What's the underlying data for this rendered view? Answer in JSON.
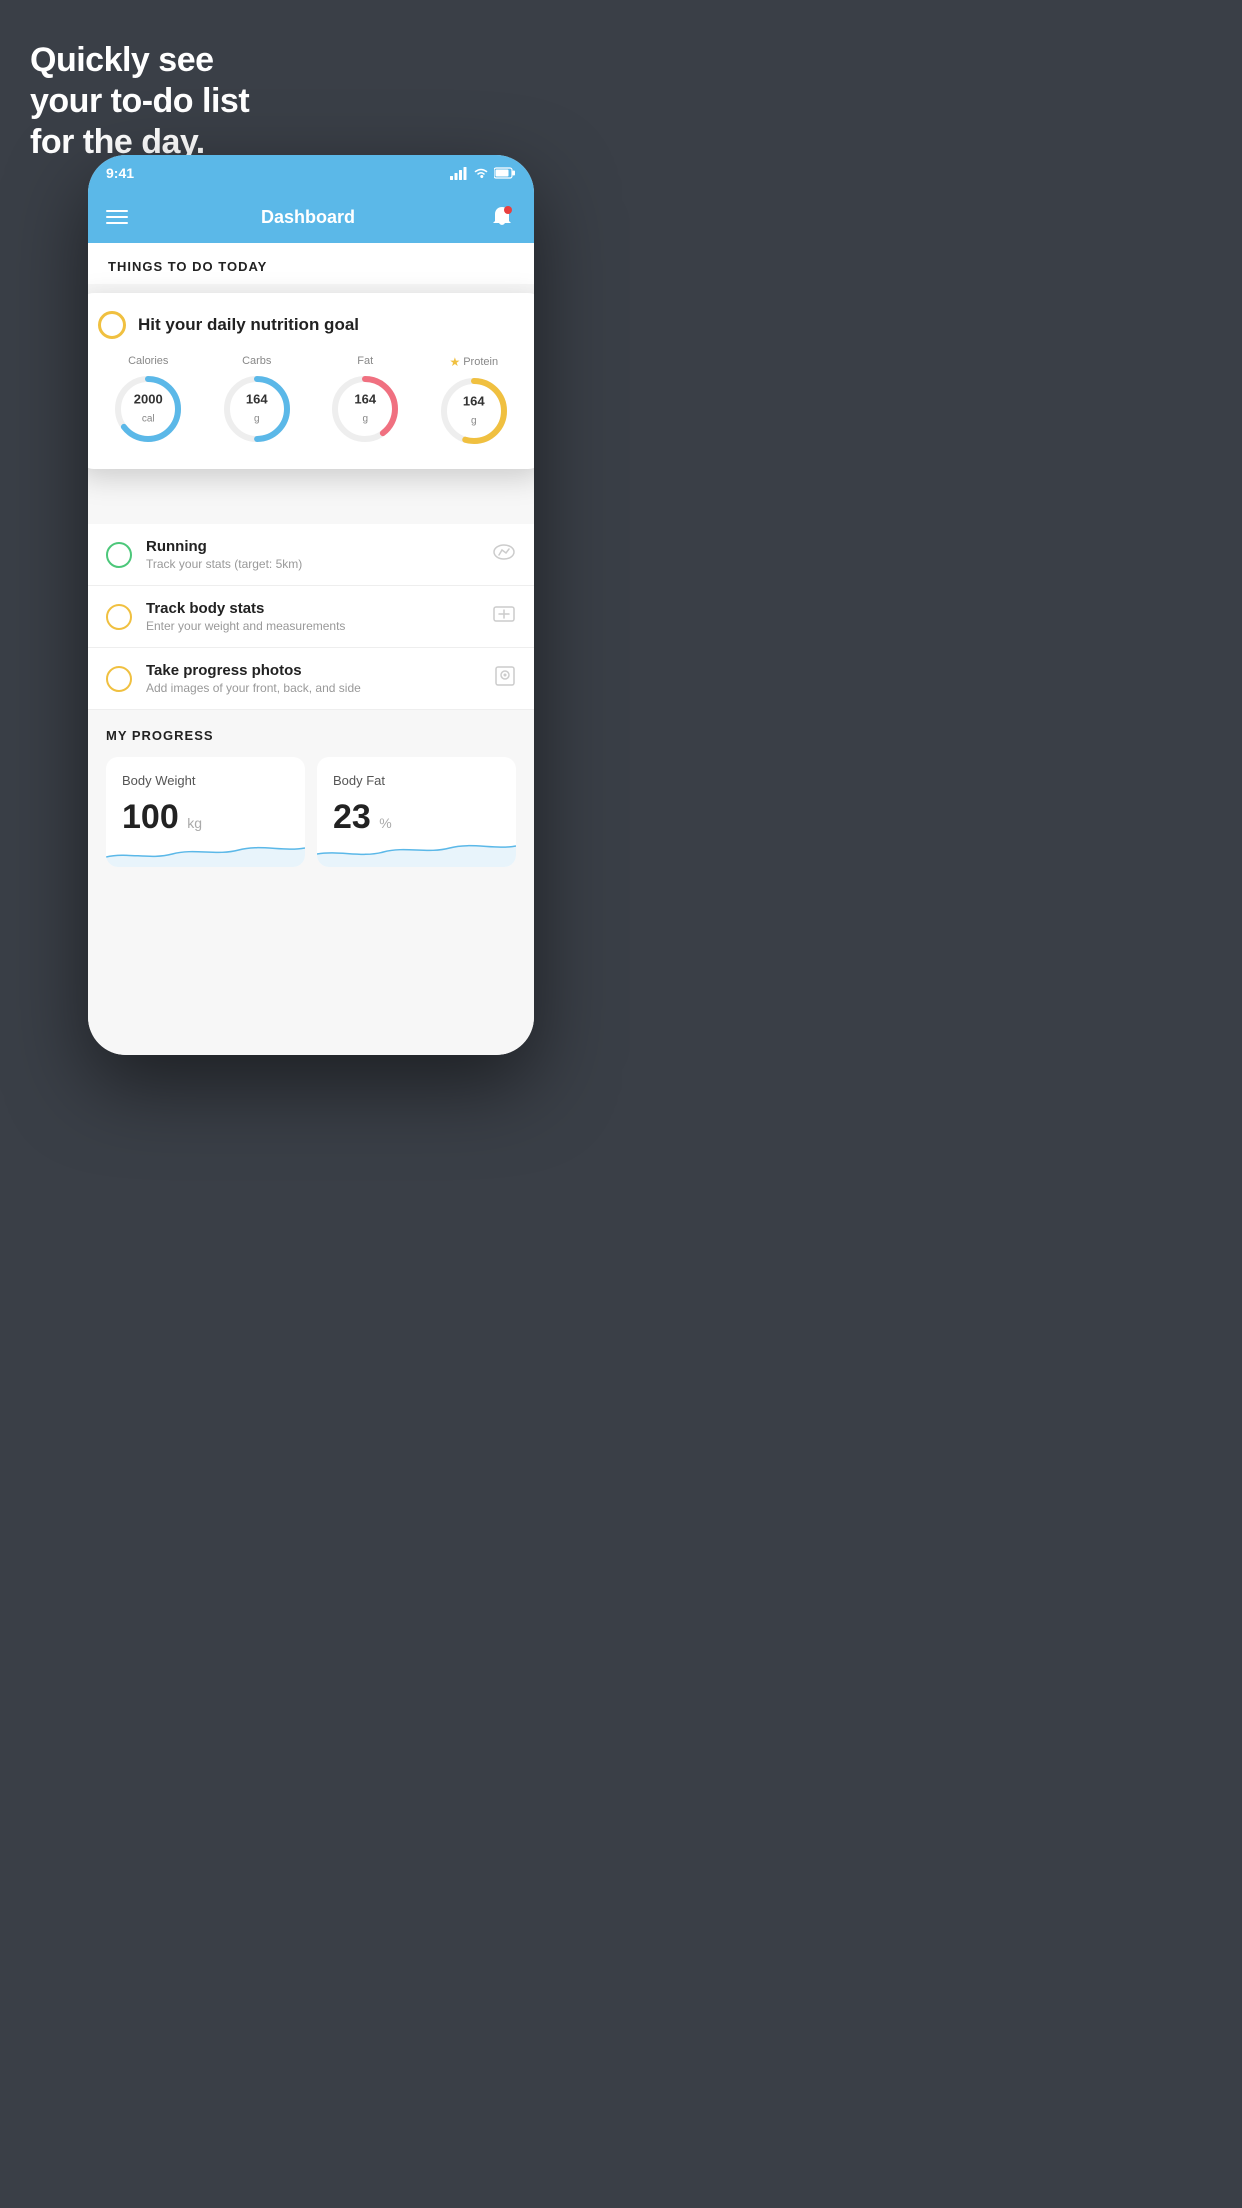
{
  "headline": {
    "line1": "Quickly see",
    "line2": "your to-do list",
    "line3": "for the day."
  },
  "phone": {
    "status_bar": {
      "time": "9:41",
      "signal_icon": "▋▋▋▋",
      "wifi_icon": "wifi",
      "battery_icon": "battery"
    },
    "nav": {
      "title": "Dashboard"
    },
    "todo_header": "THINGS TO DO TODAY",
    "nutrition_card": {
      "title": "Hit your daily nutrition goal",
      "items": [
        {
          "label": "Calories",
          "value": "2000",
          "unit": "cal",
          "color": "#5bb8e8",
          "pct": 65
        },
        {
          "label": "Carbs",
          "value": "164",
          "unit": "g",
          "color": "#5bb8e8",
          "pct": 50
        },
        {
          "label": "Fat",
          "value": "164",
          "unit": "g",
          "color": "#f07080",
          "pct": 40
        },
        {
          "label": "Protein",
          "value": "164",
          "unit": "g",
          "color": "#f0c040",
          "pct": 55,
          "starred": true
        }
      ]
    },
    "todo_items": [
      {
        "title": "Running",
        "subtitle": "Track your stats (target: 5km)",
        "circle_color": "green",
        "icon": "👟"
      },
      {
        "title": "Track body stats",
        "subtitle": "Enter your weight and measurements",
        "circle_color": "yellow",
        "icon": "⚖"
      },
      {
        "title": "Take progress photos",
        "subtitle": "Add images of your front, back, and side",
        "circle_color": "yellow",
        "icon": "👤"
      }
    ],
    "progress_section": {
      "label": "MY PROGRESS",
      "cards": [
        {
          "title": "Body Weight",
          "value": "100",
          "unit": "kg"
        },
        {
          "title": "Body Fat",
          "value": "23",
          "unit": "%"
        }
      ]
    }
  }
}
